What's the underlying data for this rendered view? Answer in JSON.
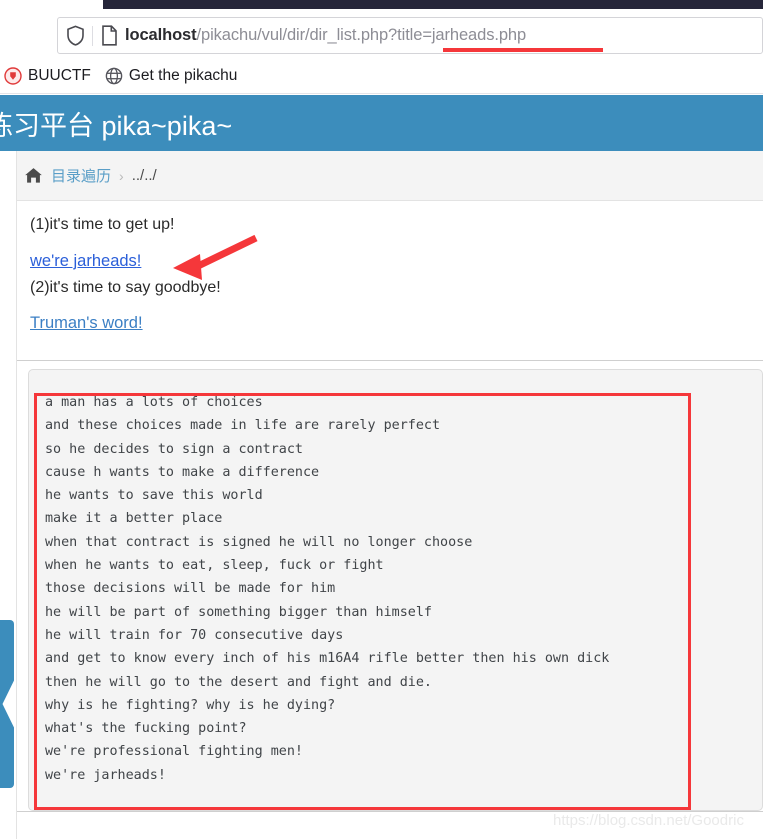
{
  "browser": {
    "url_host": "localhost",
    "url_path": "/pikachu/vul/dir/dir_list.php?title=jarheads.php",
    "url_full": "localhost/pikachu/vul/dir/dir_list.php?title=jarheads.php",
    "shield_icon": "shield-icon",
    "page_icon": "page-document-icon",
    "bookmarks": [
      {
        "label": "BUUCTF",
        "icon": "buuctf-favicon"
      },
      {
        "label": "Get the pikachu",
        "icon": "globe-icon"
      }
    ]
  },
  "page": {
    "header_title": "练习平台 pika~pika~",
    "breadcrumb": {
      "home_icon": "home-icon",
      "link": "目录遍历",
      "separator": "›",
      "current": "../../"
    },
    "body": {
      "line_1": "(1)it's time to get up!",
      "jarheads_link": "we're jarheads!",
      "line_2": "(2)it's time to say goodbye!",
      "truman_link": "Truman's word!",
      "poem": "a man has a lots of choices\nand these choices made in life are rarely perfect\nso he decides to sign a contract\ncause h wants to make a difference\nhe wants to save this world\nmake it a better place\nwhen that contract is signed he will no longer choose\nwhen he wants to eat, sleep, fuck or fight\nthose decisions will be made for him\nhe will be part of something bigger than himself\nhe will train for 70 consecutive days\nand get to know every inch of his m16A4 rifle better then his own dick\nthen he will go to the desert and fight and die.\nwhy is he fighting? why is he dying?\nwhat's the fucking point?\nwe're professional fighting men!\nwe're jarheads!"
    }
  },
  "annotations": {
    "accent_color": "#f5373a",
    "url_underline": "underline under ?title=jarheads.php",
    "arrow": "arrow pointing at the we're jarheads! link",
    "box": "rectangle around the poem output block"
  },
  "watermark": "https://blog.csdn.net/Goodric",
  "colors": {
    "header_blue": "#3c8dbc",
    "link_blue": "#3b7fc4",
    "visited_link": "#2b5fd9",
    "annotation_red": "#f5373a",
    "pre_background": "#f4f4f4",
    "strip_background": "#f4f4f4"
  }
}
